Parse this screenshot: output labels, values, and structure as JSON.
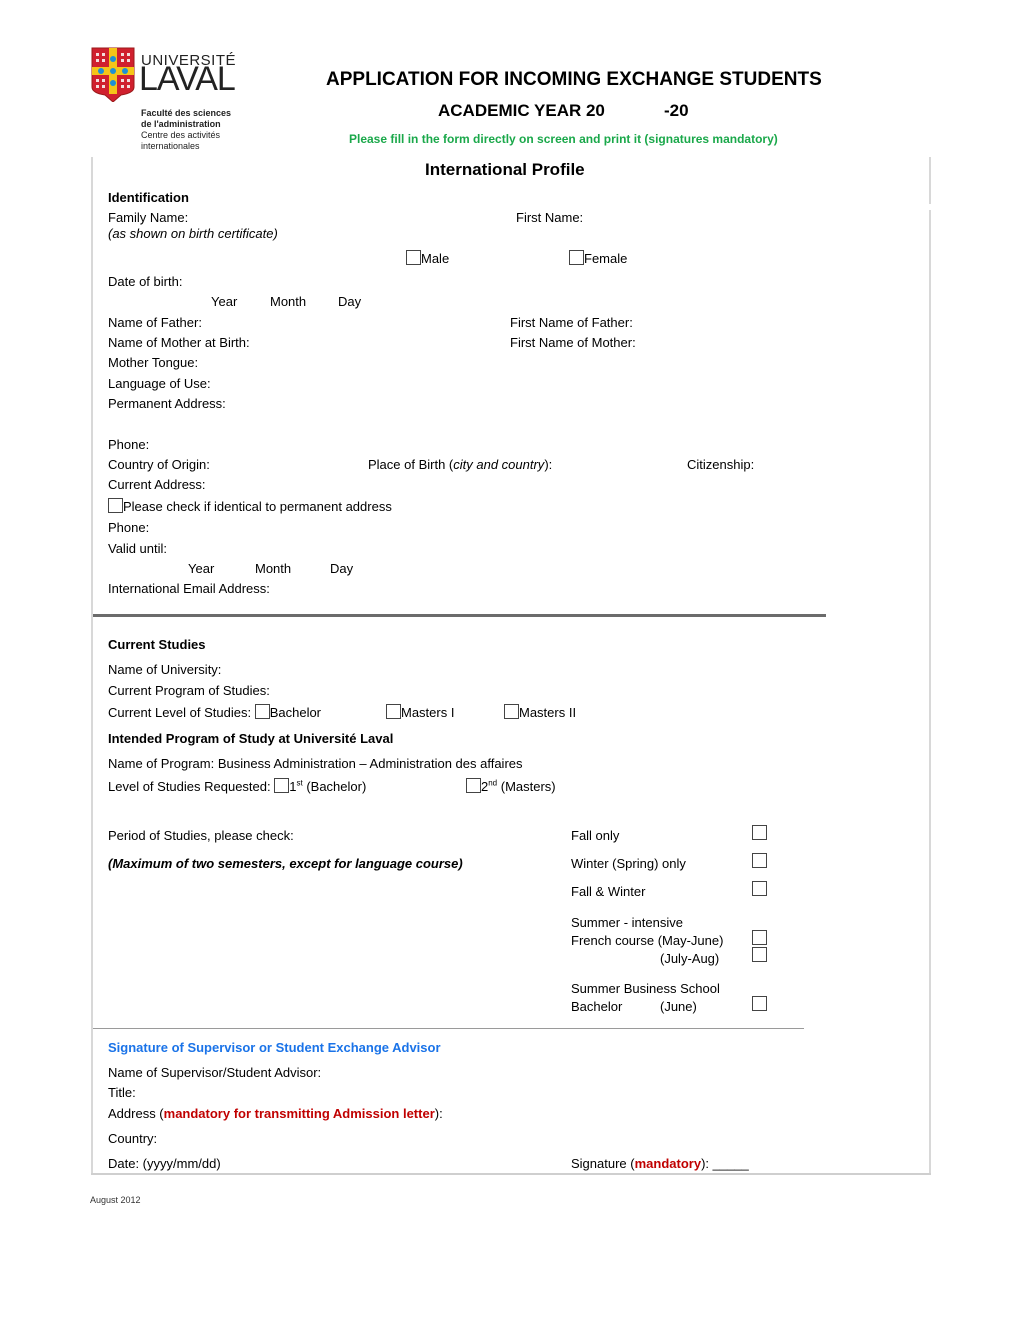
{
  "logo": {
    "university_line1": "UNIVERSITÉ",
    "university_line2": "LAVAL",
    "faculty_line1": "Faculté des sciences",
    "faculty_line2": "de l'administration",
    "center_line1": "Centre des activités",
    "center_line2": "internationales",
    "shield_colors": {
      "red": "#d0202e",
      "gold": "#f5c518",
      "blue": "#1e90d6"
    }
  },
  "header": {
    "title": "APPLICATION FOR INCOMING EXCHANGE STUDENTS",
    "academic_year_prefix": "ACADEMIC YEAR 20",
    "academic_year_suffix": "-20",
    "instruction": "Please fill in the form directly on screen and print it (signatures mandatory)",
    "instruction_color": "#1aa84a",
    "section_title": "International Profile"
  },
  "identification": {
    "heading": "Identification",
    "family_name": "Family Name:",
    "family_name_note": "(as shown on birth certificate)",
    "first_name": "First Name:",
    "male": "Male",
    "female": "Female",
    "date_of_birth": "Date of birth:",
    "dob_year": "Year",
    "dob_month": "Month",
    "dob_day": "Day",
    "name_of_father": "Name of Father:",
    "first_name_of_father": "First Name of Father:",
    "name_of_mother": "Name of Mother at Birth:",
    "first_name_of_mother": "First Name of Mother:",
    "mother_tongue": "Mother Tongue:",
    "language_of_use": "Language of Use:",
    "permanent_address": "Permanent Address:",
    "phone": "Phone:",
    "country_of_origin": "Country of Origin:",
    "place_of_birth_prefix": "Place of Birth (",
    "place_of_birth_italic": "city and country",
    "place_of_birth_suffix": "):",
    "citizenship": "Citizenship:",
    "current_address": "Current Address:",
    "identical_check": "Please check if identical to permanent address",
    "phone2": "Phone:",
    "valid_until": "Valid until:",
    "valid_year": "Year",
    "valid_month": "Month",
    "valid_day": "Day",
    "email": "International Email Address:"
  },
  "studies": {
    "heading": "Current Studies",
    "university": "Name of University:",
    "program": "Current Program of Studies:",
    "level_label": "Current Level of Studies:",
    "level_bachelor": "Bachelor",
    "level_masters1": "Masters I",
    "level_masters2": "Masters II",
    "intended_heading": "Intended Program of Study at Université Laval",
    "program_name": "Name of Program: Business Administration – Administration des affaires",
    "requested_label": "Level of Studies Requested:",
    "req1_num": "1",
    "req1_sup": "st",
    "req1_text": " (Bachelor)",
    "req2_num": "2",
    "req2_sup": "nd",
    "req2_text": " (Masters)"
  },
  "period": {
    "label": "Period of Studies, please check:",
    "note": "(Maximum of two semesters, except for language course)",
    "fall_only": "Fall only",
    "winter_only": "Winter (Spring) only",
    "fall_winter": "Fall & Winter",
    "summer_line1": "Summer - intensive",
    "summer_line2": "French course (May-June)",
    "summer_line3": "(July-Aug)",
    "sbs_line1": "Summer Business School",
    "sbs_line2a": "Bachelor",
    "sbs_line2b": "(June)"
  },
  "signature": {
    "heading": "Signature of Supervisor or Student Exchange Advisor",
    "heading_color": "#1a73e8",
    "name": "Name of Supervisor/Student Advisor:",
    "title": "Title:",
    "address_prefix": "Address (",
    "address_mandatory": "mandatory for transmitting Admission letter",
    "address_suffix": "):",
    "country": "Country:",
    "date": "Date: (yyyy/mm/dd)",
    "signature_prefix": "Signature (",
    "signature_mandatory": "mandatory",
    "signature_suffix": "): _____",
    "mandatory_color": "#c00000"
  },
  "footer": {
    "date": "August 2012"
  }
}
